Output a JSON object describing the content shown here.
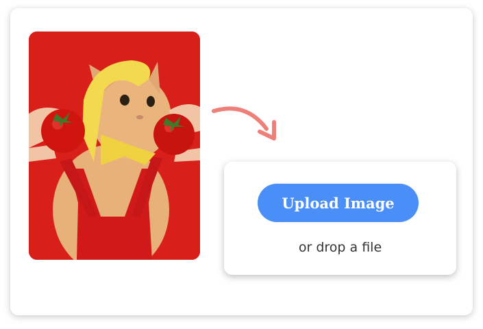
{
  "upload": {
    "button_label": "Upload Image",
    "drop_text": "or drop a file"
  },
  "colors": {
    "button": "#4a8ef7",
    "arrow": "#ef8079",
    "photo_background": "#d81f1a"
  },
  "icons": {
    "arrow": "curved-arrow-icon"
  }
}
